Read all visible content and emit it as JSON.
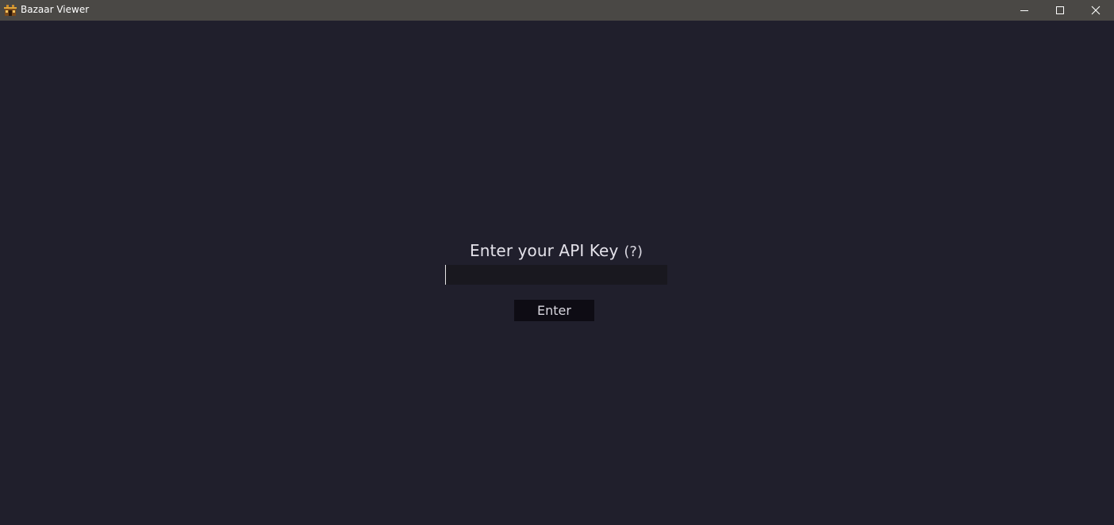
{
  "window": {
    "title": "Bazaar Viewer",
    "app_icon": "bazaar-app-icon",
    "controls": {
      "minimize_icon": "minimize-icon",
      "maximize_icon": "maximize-icon",
      "close_icon": "close-icon"
    }
  },
  "login": {
    "prompt": "Enter your API Key",
    "help": "(?)",
    "api_key_value": "",
    "api_key_placeholder": "",
    "submit_label": "Enter"
  },
  "colors": {
    "background": "#201f2c",
    "titlebar": "#4a4845",
    "input_background": "#19181f",
    "button_background": "#0e0c14",
    "text": "#e4e2ea"
  }
}
